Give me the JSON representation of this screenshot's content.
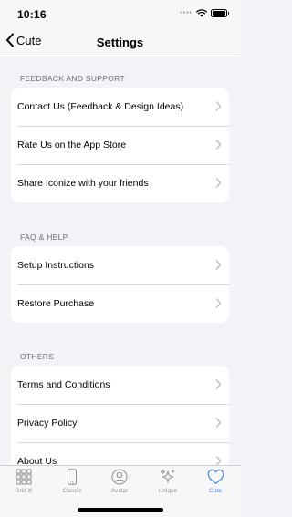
{
  "status_bar": {
    "time": "10:16",
    "signal_icon": "signal-dots-icon",
    "wifi_icon": "wifi-icon",
    "battery_icon": "battery-icon"
  },
  "nav": {
    "back_label": "Cute",
    "back_icon": "chevron-left-icon",
    "title": "Settings"
  },
  "sections": [
    {
      "header": "FEEDBACK AND SUPPORT",
      "items": [
        {
          "label": "Contact Us (Feedback & Design Ideas)"
        },
        {
          "label": "Rate Us on the App Store"
        },
        {
          "label": "Share Iconize with your friends"
        }
      ]
    },
    {
      "header": "FAQ & HELP",
      "items": [
        {
          "label": "Setup Instructions"
        },
        {
          "label": "Restore Purchase"
        }
      ]
    },
    {
      "header": "OTHERS",
      "items": [
        {
          "label": "Terms and Conditions"
        },
        {
          "label": "Privacy Policy"
        },
        {
          "label": "About Us"
        }
      ]
    }
  ],
  "tabs": [
    {
      "label": "Grid it!",
      "icon": "grid-icon",
      "active": false
    },
    {
      "label": "Classic",
      "icon": "phone-icon",
      "active": false
    },
    {
      "label": "Avatar",
      "icon": "avatar-icon",
      "active": false
    },
    {
      "label": "Unique",
      "icon": "sparkles-icon",
      "active": false
    },
    {
      "label": "Cute",
      "icon": "heart-icon",
      "active": true
    }
  ],
  "colors": {
    "background": "#f2f2f7",
    "accent": "#3478f6",
    "inactive": "#8e8e93",
    "chevron": "#c4c4c7"
  }
}
